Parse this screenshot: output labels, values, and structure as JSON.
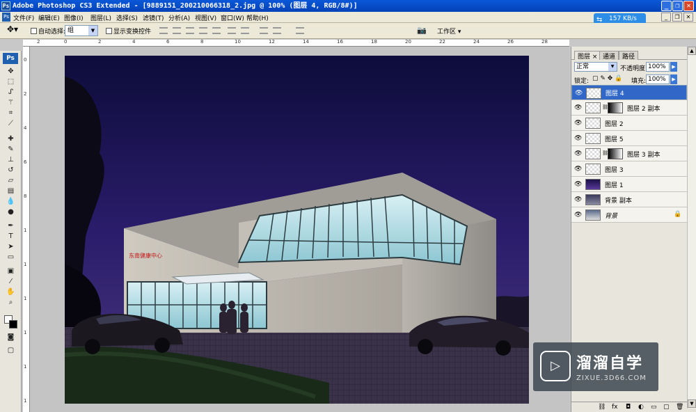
{
  "window": {
    "title": "Adobe Photoshop CS3 Extended - [9889151_200210066318_2.jpg @ 100% (图层 4, RGB/8#)]",
    "app_icon": "Ps",
    "minimize": "_",
    "restore": "❐",
    "close": "✕"
  },
  "menu": {
    "items": [
      "文件(F)",
      "编辑(E)",
      "图像(I)",
      "图层(L)",
      "选择(S)",
      "滤镜(T)",
      "分析(A)",
      "视图(V)",
      "窗口(W)",
      "帮助(H)"
    ]
  },
  "network_badge": {
    "text": "157 KB/s"
  },
  "options_bar": {
    "auto_select_label": "自动选择:",
    "auto_select_value": "组",
    "show_transform_label": "显示变换控件",
    "workspace_label": "工作区"
  },
  "rulers": {
    "top_ticks": [
      "2",
      "0",
      "2",
      "4",
      "6",
      "8",
      "10",
      "12",
      "14",
      "16",
      "18",
      "20",
      "22",
      "24",
      "26",
      "28"
    ],
    "left_ticks": [
      "0",
      "2",
      "4",
      "6",
      "8",
      "1",
      "1",
      "1",
      "1",
      "1",
      "1"
    ]
  },
  "toolbox": {
    "logo": "Ps",
    "tools": [
      "move-tool",
      "marquee-tool",
      "lasso-tool",
      "magic-wand-tool",
      "crop-tool",
      "eyedropper-tool",
      "healing-tool",
      "brush-tool",
      "stamp-tool",
      "history-brush-tool",
      "eraser-tool",
      "gradient-tool",
      "blur-tool",
      "dodge-tool",
      "pen-tool",
      "type-tool",
      "path-select-tool",
      "shape-tool",
      "notes-tool",
      "eyedropper2-tool",
      "hand-tool",
      "zoom-tool"
    ]
  },
  "photo": {
    "sign_text": "东南健康中心"
  },
  "layers_panel": {
    "tabs": [
      "图层 ×",
      "通道",
      "路径"
    ],
    "blend_mode": "正常",
    "opacity_label": "不透明度:",
    "opacity_value": "100%",
    "lock_label": "锁定:",
    "fill_label": "填充:",
    "fill_value": "100%",
    "layers": [
      {
        "name": "图层 4",
        "selected": true,
        "mask": false
      },
      {
        "name": "图层 2 副本",
        "selected": false,
        "mask": true
      },
      {
        "name": "图层 2",
        "selected": false,
        "mask": false
      },
      {
        "name": "图层 5",
        "selected": false,
        "mask": false
      },
      {
        "name": "图层 3 副本",
        "selected": false,
        "mask": true
      },
      {
        "name": "图层 3",
        "selected": false,
        "mask": false
      },
      {
        "name": "图层 1",
        "selected": false,
        "mask": false
      },
      {
        "name": "背景 副本",
        "selected": false,
        "mask": false
      },
      {
        "name": "背景",
        "selected": false,
        "mask": false,
        "locked": true
      }
    ]
  },
  "watermark": {
    "title": "溜溜自学",
    "subtitle": "ZIXUE.3D66.COM"
  }
}
